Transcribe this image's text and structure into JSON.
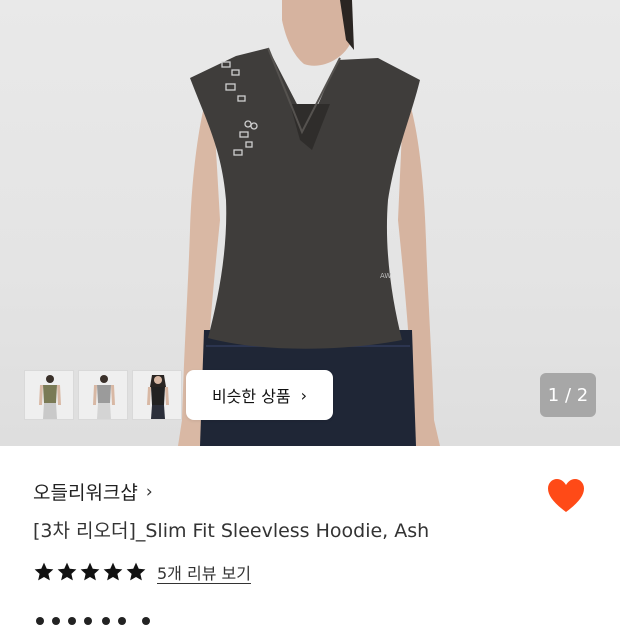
{
  "gallery": {
    "pager_text": "1 / 2",
    "similar_button_label": "비슷한 상품",
    "thumbnails": [
      {
        "color": "olive"
      },
      {
        "color": "grey"
      },
      {
        "color": "black"
      }
    ]
  },
  "product": {
    "brand": "오들리워크샵",
    "title": "[3차 리오더]_Slim Fit Sleevless Hoodie, Ash",
    "rating_stars": 5,
    "review_link": "5개 리뷰 보기"
  },
  "icons": {
    "brand_chevron": "chevron-right-icon",
    "wishlist": "heart-icon",
    "star": "star-icon"
  },
  "colors": {
    "heart": "#ff4a17",
    "star": "#111111",
    "top_fabric": "#3f3d3b",
    "jeans": "#1f2636"
  }
}
